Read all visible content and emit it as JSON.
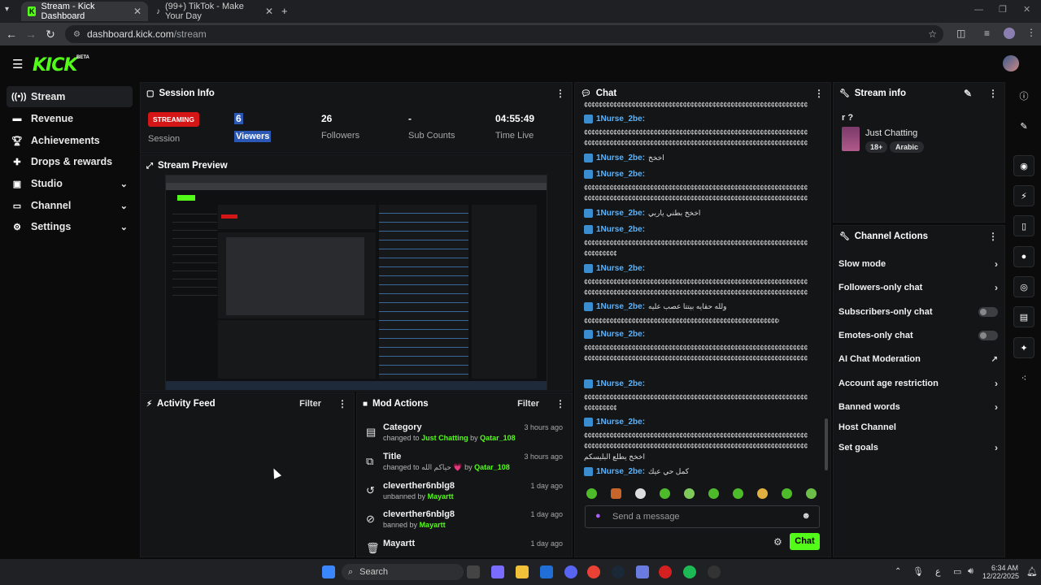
{
  "browser": {
    "tabs": [
      {
        "label": "Stream - Kick Dashboard"
      },
      {
        "label": "(99+) TikTok - Make Your Day"
      }
    ],
    "url_host": "dashboard.kick.com",
    "url_path": "/stream"
  },
  "header": {
    "logo": "KICK",
    "beta": "BETA"
  },
  "sidebar": {
    "items": [
      {
        "label": "Stream",
        "icon": "broadcast-icon"
      },
      {
        "label": "Revenue",
        "icon": "revenue-icon"
      },
      {
        "label": "Achievements",
        "icon": "trophy-icon"
      },
      {
        "label": "Drops & rewards",
        "icon": "gift-icon"
      },
      {
        "label": "Studio",
        "icon": "studio-icon"
      },
      {
        "label": "Channel",
        "icon": "channel-icon"
      },
      {
        "label": "Settings",
        "icon": "gear-icon"
      }
    ]
  },
  "session": {
    "title": "Session Info",
    "status": "STREAMING",
    "status_label": "Session",
    "stats": [
      {
        "value": "6",
        "label": "Viewers"
      },
      {
        "value": "26",
        "label": "Followers"
      },
      {
        "value": "-",
        "label": "Sub Counts"
      },
      {
        "value": "04:55:49",
        "label": "Time Live"
      }
    ]
  },
  "preview": {
    "title": "Stream Preview"
  },
  "activity": {
    "title": "Activity Feed",
    "filter": "Filter"
  },
  "mod_actions": {
    "title": "Mod Actions",
    "filter": "Filter",
    "items": [
      {
        "title": "Category",
        "pre": "changed to",
        "target": "Just Chatting",
        "by": "by",
        "user": "Qatar_108",
        "time": "3 hours ago",
        "icon": "category-icon"
      },
      {
        "title": "Title",
        "pre": "changed to",
        "target": "حياكم الله 💗",
        "by": "by",
        "user": "Qatar_108",
        "time": "3 hours ago",
        "icon": "title-icon"
      },
      {
        "title": "cleverther6nblg8",
        "pre": "unbanned by",
        "target": "",
        "by": "",
        "user": "Mayartt",
        "time": "1 day ago",
        "icon": "unban-icon"
      },
      {
        "title": "cleverther6nblg8",
        "pre": "banned by",
        "target": "",
        "by": "",
        "user": "Mayartt",
        "time": "1 day ago",
        "icon": "ban-icon"
      },
      {
        "title": "Mayartt",
        "pre": "",
        "target": "",
        "by": "",
        "user": "",
        "time": "1 day ago",
        "icon": "trash-icon"
      }
    ]
  },
  "chat": {
    "title": "Chat",
    "user": "1Nurse_2be:",
    "messages": [
      {
        "text": "¢¢¢¢¢¢¢¢¢¢¢¢¢¢¢¢¢¢¢¢¢¢¢¢¢¢¢¢¢¢¢¢¢¢¢¢¢¢¢¢¢¢¢¢¢¢¢¢¢¢¢¢¢¢¢¢¢¢¢¢¢"
      },
      {
        "text": "اخخخ"
      },
      {
        "text": "¢¢¢¢¢¢¢¢¢¢¢¢¢¢¢¢¢¢¢¢¢¢¢¢¢¢¢¢¢¢¢¢¢¢¢¢¢¢¢¢¢¢¢¢¢¢¢¢¢¢¢¢¢¢¢¢¢¢¢¢¢"
      },
      {
        "text": "اخخخ بطني ياربي"
      },
      {
        "text": "¢¢¢¢¢¢¢¢¢¢¢¢¢¢¢¢¢¢¢¢¢¢¢¢¢¢¢¢¢¢¢¢¢¢¢¢¢¢¢¢¢¢¢¢¢¢¢¢¢¢¢¢¢¢¢¢¢¢¢¢¢"
      },
      {
        "text": "¢¢¢¢¢¢¢¢¢¢¢¢¢¢¢¢¢¢¢¢¢¢¢¢¢¢¢¢¢¢¢¢¢¢¢¢¢¢¢¢¢¢¢¢¢¢¢¢¢¢¢¢¢¢¢¢¢¢¢¢¢"
      },
      {
        "text": "ولله حقايه بيتتا عصب عليه"
      },
      {
        "text": "¢¢¢¢¢¢¢¢¢¢¢¢¢¢¢¢¢¢¢¢¢¢¢¢¢¢¢¢¢¢¢¢¢¢¢¢¢¢¢¢¢¢¢¢¢¢¢¢¢¢¢¢¢¢¢¢¢¢¢¢¢"
      },
      {
        "text": "¢¢¢¢¢¢¢¢¢¢¢¢¢¢¢¢¢¢¢¢¢¢¢¢¢¢¢¢¢¢¢¢¢¢¢¢¢¢¢¢¢¢¢¢¢¢¢¢¢¢¢¢¢¢¢¢¢¢¢¢¢"
      },
      {
        "text": "اخخخ يطلع البليسكم"
      },
      {
        "text": "كمل حي عيك"
      }
    ],
    "input_placeholder": "Send a message",
    "send_label": "Chat"
  },
  "stream_info": {
    "title": "Stream info",
    "stream_title": "r ?",
    "category": "Just Chatting",
    "tags": [
      "18+",
      "Arabic"
    ]
  },
  "channel_actions": {
    "title": "Channel Actions",
    "items": [
      {
        "label": "Slow mode",
        "control": "arrow"
      },
      {
        "label": "Followers-only chat",
        "control": "arrow"
      },
      {
        "label": "Subscribers-only chat",
        "control": "toggle"
      },
      {
        "label": "Emotes-only chat",
        "control": "toggle"
      },
      {
        "label": "AI Chat Moderation",
        "control": "external"
      },
      {
        "label": "Account age restriction",
        "control": "arrow"
      },
      {
        "label": "Banned words",
        "control": "arrow"
      },
      {
        "label": "Host Channel",
        "control": "none"
      },
      {
        "label": "Set goals",
        "control": "arrow"
      }
    ]
  },
  "taskbar": {
    "search": "Search",
    "lang": "ع",
    "time": "6:34 AM",
    "date": "12/22/2025"
  },
  "colors": {
    "accent": "#53fc18",
    "live": "#d41616",
    "chat_user": "#59b4ff"
  }
}
